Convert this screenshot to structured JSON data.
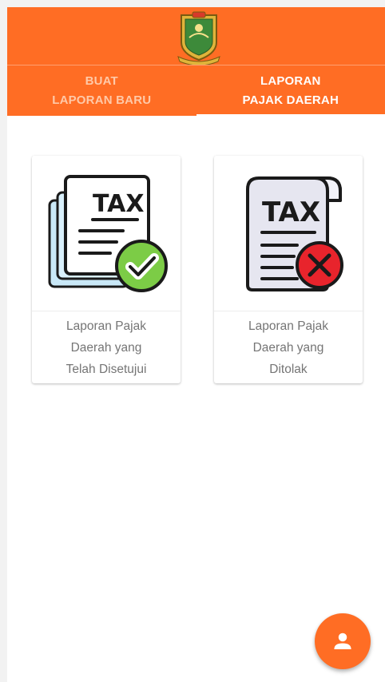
{
  "app": {
    "logo_icon": "regional-emblem-icon",
    "accent_color": "#ff6d24"
  },
  "tabs": [
    {
      "line1": "BUAT",
      "line2": "LAPORAN BARU",
      "active": false
    },
    {
      "line1": "LAPORAN",
      "line2": "PAJAK DAERAH",
      "active": true
    }
  ],
  "cards": [
    {
      "icon": "tax-document-approved-icon",
      "icon_text": "TAX",
      "label_lines": [
        "Laporan Pajak",
        "Daerah yang",
        "Telah Disetujui"
      ]
    },
    {
      "icon": "tax-document-rejected-icon",
      "icon_text": "TAX",
      "label_lines": [
        "Laporan Pajak",
        "Daerah yang",
        "Ditolak"
      ]
    }
  ],
  "fab": {
    "icon": "person-icon"
  }
}
